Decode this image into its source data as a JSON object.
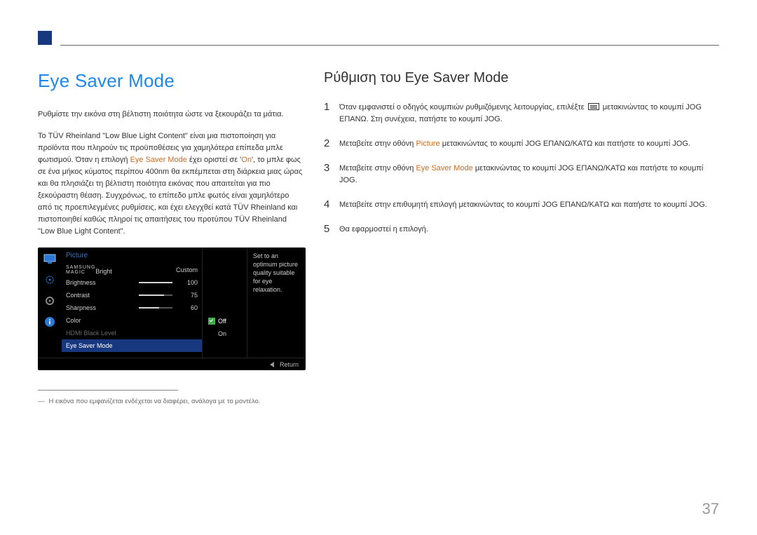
{
  "page_number": "37",
  "left": {
    "heading": "Eye Saver Mode",
    "para1": "Ρυθμίστε την εικόνα στη βέλτιστη ποιότητα ώστε να ξεκουράζει τα μάτια.",
    "para2_a": "Το TÜV Rheinland \"Low Blue Light Content\" είναι μια πιστοποίηση για προϊόντα που πληρούν τις προϋποθέσεις για χαμηλότερα επίπεδα μπλε φωτισμού. Όταν η επιλογή ",
    "para2_accent1": "Eye Saver Mode",
    "para2_b": " έχει οριστεί σε '",
    "para2_accent2": "On",
    "para2_c": "', το μπλε φως σε ένα μήκος κύματος περίπου 400nm θα εκπέμπεται στη διάρκεια μιας ώρας και θα πλησιάζει τη βέλτιστη ποιότητα εικόνας που απαιτείται για πιο ξεκούραστη θέαση. Συγχρόνως, το επίπεδο μπλε φωτός είναι χαμηλότερο από τις προεπιλεγμένες ρυθμίσεις, και έχει ελεγχθεί κατά TÜV Rheinland και πιστοποιηθεί καθώς πληροί τις απαιτήσεις του προτύπου TÜV Rheinland \"Low Blue Light Content\".",
    "footnote": "Η εικόνα που εμφανίζεται ενδέχεται να διαφέρει, ανάλογα με το μοντέλο."
  },
  "osd": {
    "title": "Picture",
    "brand_top": "SAMSUNG",
    "brand_bottom": "MAGIC",
    "rows": {
      "bright": {
        "label": "Bright",
        "value": "Custom"
      },
      "brightness": {
        "label": "Brightness",
        "value": "100",
        "pct": 100
      },
      "contrast": {
        "label": "Contrast",
        "value": "75",
        "pct": 75
      },
      "sharpness": {
        "label": "Sharpness",
        "value": "60",
        "pct": 60
      },
      "color": {
        "label": "Color"
      },
      "hdmi": {
        "label": "HDMI Black Level"
      },
      "esm": {
        "label": "Eye Saver Mode"
      }
    },
    "opts": {
      "off": "Off",
      "on": "On"
    },
    "help": "Set to an optimum picture quality suitable for eye relaxation.",
    "footer_return": "Return"
  },
  "right": {
    "heading": "Ρύθμιση του Eye Saver Mode",
    "steps": {
      "s1a": "Όταν εμφανιστεί ο οδηγός κουμπιών ρυθμιζόμενης λειτουργίας, επιλέξτε ",
      "s1b": " μετακινώντας το κουμπί JOG ΕΠΑΝΩ. Στη συνέχεια, πατήστε το κουμπί JOG.",
      "s2a": "Μεταβείτε στην οθόνη ",
      "s2_accent": "Picture",
      "s2b": " μετακινώντας το κουμπί JOG ΕΠΑΝΩ/ΚΑΤΩ και πατήστε το κουμπί JOG.",
      "s3a": "Μεταβείτε στην οθόνη ",
      "s3_accent": "Eye Saver Mode",
      "s3b": " μετακινώντας το κουμπί JOG ΕΠΑΝΩ/ΚΑΤΩ και πατήστε το κουμπί JOG.",
      "s4": "Μεταβείτε στην επιθυμητή επιλογή μετακινώντας το κουμπί JOG ΕΠΑΝΩ/ΚΑΤΩ και πατήστε το κουμπί JOG.",
      "s5": "Θα εφαρμοστεί η επιλογή."
    }
  }
}
